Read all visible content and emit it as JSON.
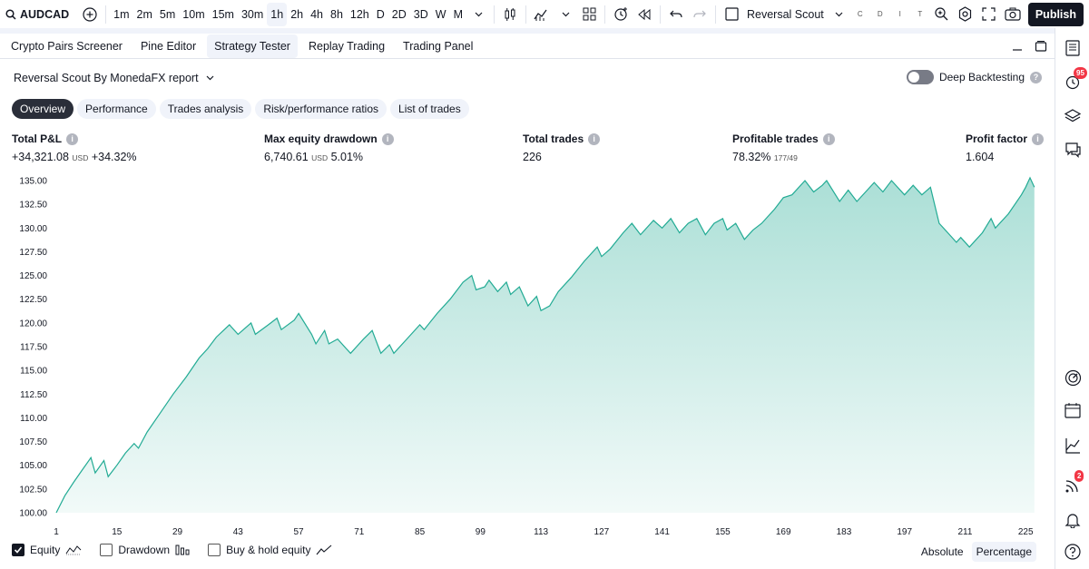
{
  "toolbar": {
    "symbol": "AUDCAD",
    "intervals": [
      "1m",
      "2m",
      "5m",
      "10m",
      "15m",
      "30m",
      "1h",
      "2h",
      "4h",
      "8h",
      "12h",
      "D",
      "2D",
      "3D",
      "W",
      "M"
    ],
    "active_interval": "1h",
    "indicator_name": "Reversal Scout",
    "mini_letters": [
      "C",
      "D",
      "I",
      "T"
    ],
    "publish_label": "Publish"
  },
  "panel_tabs": [
    "Crypto Pairs Screener",
    "Pine Editor",
    "Strategy Tester",
    "Replay Trading",
    "Trading Panel"
  ],
  "active_panel_tab": "Strategy Tester",
  "report": {
    "title": "Reversal Scout By MonedaFX report",
    "deep_backtesting_label": "Deep Backtesting"
  },
  "subtabs": [
    "Overview",
    "Performance",
    "Trades analysis",
    "Risk/performance ratios",
    "List of trades"
  ],
  "active_subtab": "Overview",
  "metrics": {
    "total_pnl": {
      "label": "Total P&L",
      "value": "+34,321.08",
      "unit": "USD",
      "pct": "+34.32%"
    },
    "max_drawdown": {
      "label": "Max equity drawdown",
      "value": "6,740.61",
      "unit": "USD",
      "pct": "5.01%"
    },
    "total_trades": {
      "label": "Total trades",
      "value": "226"
    },
    "profitable_trades": {
      "label": "Profitable trades",
      "value": "78.32%",
      "ratio": "177/49"
    },
    "profit_factor": {
      "label": "Profit factor",
      "value": "1.604"
    }
  },
  "legend": {
    "equity": "Equity",
    "drawdown": "Drawdown",
    "buy_hold": "Buy & hold equity",
    "absolute": "Absolute",
    "percentage": "Percentage"
  },
  "badges": {
    "alerts": "95",
    "news": "2"
  },
  "colors": {
    "line": "#22ab94",
    "fill": "#22ab94",
    "dark": "#131722"
  },
  "chart_data": {
    "type": "area",
    "ylim": [
      100,
      135
    ],
    "y_ticks": [
      "135.00",
      "132.50",
      "130.00",
      "127.50",
      "125.00",
      "122.50",
      "120.00",
      "117.50",
      "115.00",
      "112.50",
      "110.00",
      "107.50",
      "105.00",
      "102.50",
      "100.00"
    ],
    "x_ticks": [
      1,
      15,
      29,
      43,
      57,
      71,
      85,
      99,
      113,
      127,
      141,
      155,
      169,
      183,
      197,
      211,
      225
    ],
    "xlim": [
      1,
      226
    ],
    "series": [
      {
        "values": [
          [
            1,
            100.0
          ],
          [
            3,
            101.8
          ],
          [
            5,
            103.2
          ],
          [
            7,
            104.5
          ],
          [
            9,
            105.8
          ],
          [
            10,
            104.2
          ],
          [
            12,
            105.5
          ],
          [
            13,
            103.8
          ],
          [
            15,
            105.0
          ],
          [
            17,
            106.3
          ],
          [
            19,
            107.3
          ],
          [
            20,
            106.8
          ],
          [
            22,
            108.5
          ],
          [
            25,
            110.5
          ],
          [
            28,
            112.5
          ],
          [
            31,
            114.3
          ],
          [
            34,
            116.3
          ],
          [
            36,
            117.3
          ],
          [
            38,
            118.5
          ],
          [
            41,
            119.8
          ],
          [
            43,
            118.8
          ],
          [
            46,
            120.0
          ],
          [
            47,
            118.8
          ],
          [
            50,
            119.8
          ],
          [
            52,
            120.5
          ],
          [
            53,
            119.3
          ],
          [
            56,
            120.3
          ],
          [
            57,
            121.0
          ],
          [
            60,
            118.8
          ],
          [
            61,
            117.8
          ],
          [
            63,
            119.2
          ],
          [
            64,
            117.8
          ],
          [
            66,
            118.3
          ],
          [
            68,
            117.3
          ],
          [
            69,
            116.8
          ],
          [
            72,
            118.3
          ],
          [
            74,
            119.2
          ],
          [
            76,
            116.8
          ],
          [
            78,
            117.7
          ],
          [
            79,
            116.8
          ],
          [
            82,
            118.3
          ],
          [
            85,
            119.8
          ],
          [
            86,
            119.3
          ],
          [
            89,
            121.0
          ],
          [
            92,
            122.5
          ],
          [
            95,
            124.3
          ],
          [
            97,
            125.0
          ],
          [
            98,
            123.5
          ],
          [
            100,
            123.8
          ],
          [
            101,
            124.5
          ],
          [
            103,
            123.3
          ],
          [
            105,
            124.3
          ],
          [
            106,
            123.0
          ],
          [
            108,
            123.8
          ],
          [
            110,
            121.8
          ],
          [
            112,
            122.8
          ],
          [
            113,
            121.3
          ],
          [
            115,
            121.8
          ],
          [
            117,
            123.3
          ],
          [
            120,
            124.8
          ],
          [
            123,
            126.5
          ],
          [
            126,
            128.0
          ],
          [
            127,
            127.0
          ],
          [
            129,
            127.8
          ],
          [
            132,
            129.5
          ],
          [
            134,
            130.5
          ],
          [
            136,
            129.3
          ],
          [
            138,
            130.3
          ],
          [
            139,
            130.8
          ],
          [
            141,
            130.0
          ],
          [
            143,
            131.0
          ],
          [
            145,
            129.5
          ],
          [
            147,
            130.5
          ],
          [
            149,
            131.0
          ],
          [
            151,
            129.3
          ],
          [
            153,
            130.5
          ],
          [
            155,
            131.0
          ],
          [
            156,
            129.8
          ],
          [
            158,
            130.5
          ],
          [
            160,
            128.8
          ],
          [
            162,
            129.8
          ],
          [
            164,
            130.5
          ],
          [
            167,
            132.0
          ],
          [
            169,
            133.2
          ],
          [
            171,
            133.5
          ],
          [
            174,
            135.0
          ],
          [
            176,
            133.8
          ],
          [
            178,
            134.5
          ],
          [
            179,
            135.0
          ],
          [
            182,
            132.8
          ],
          [
            184,
            134.0
          ],
          [
            186,
            132.8
          ],
          [
            188,
            133.8
          ],
          [
            190,
            134.8
          ],
          [
            192,
            133.8
          ],
          [
            194,
            135.0
          ],
          [
            197,
            133.5
          ],
          [
            199,
            134.5
          ],
          [
            201,
            133.5
          ],
          [
            203,
            134.3
          ],
          [
            205,
            130.5
          ],
          [
            207,
            129.5
          ],
          [
            209,
            128.5
          ],
          [
            210,
            129.0
          ],
          [
            212,
            128.0
          ],
          [
            215,
            129.5
          ],
          [
            217,
            131.0
          ],
          [
            218,
            130.0
          ],
          [
            221,
            131.5
          ],
          [
            224,
            133.5
          ],
          [
            225,
            134.3
          ],
          [
            226,
            135.3
          ],
          [
            227,
            134.3
          ]
        ]
      }
    ]
  }
}
